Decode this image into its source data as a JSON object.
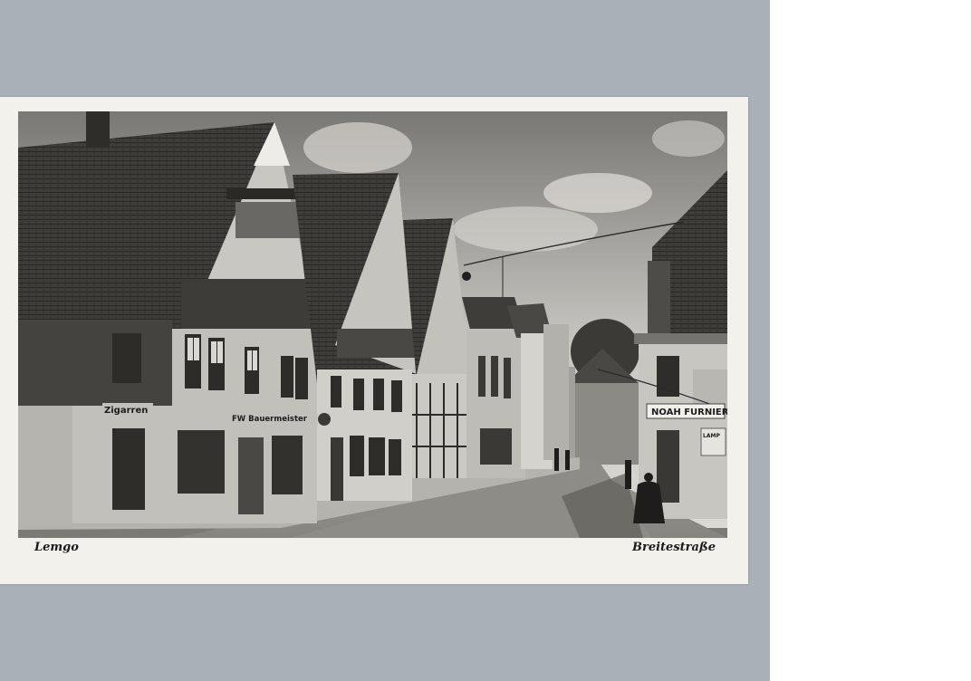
{
  "caption": {
    "town": "Lemgo",
    "street": "Breitestraße"
  },
  "signs": {
    "shop_left": "Zigarren",
    "shop_mid": "FW Bauermeister",
    "shop_right": "NOAH FURNIER",
    "plate_right": "LAMP"
  }
}
